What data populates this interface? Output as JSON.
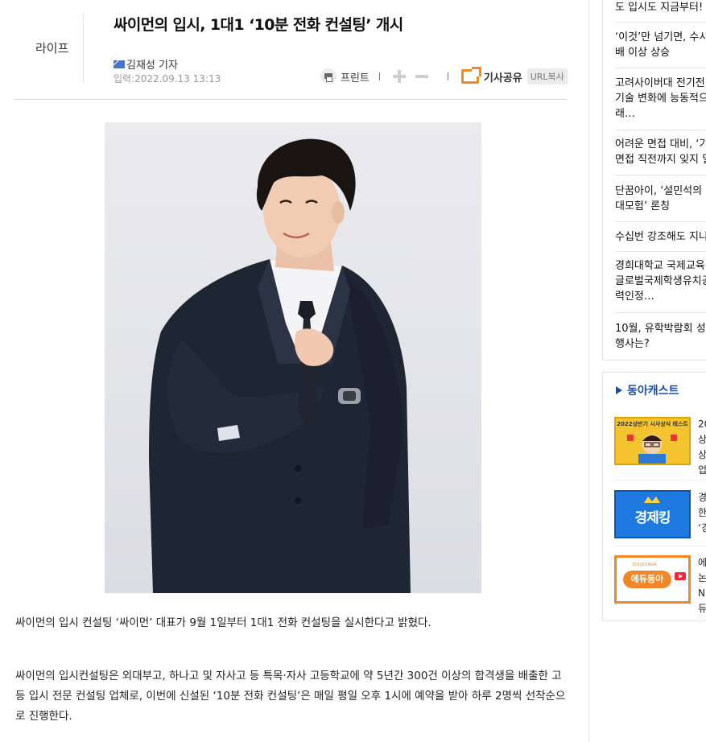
{
  "article": {
    "section": "라이프",
    "title": "싸이먼의 입시, 1대1 ‘10분 전화 컨설팅’ 개시",
    "author": "김재성 기자",
    "date": "입력:2022.09.13 13:13",
    "tools": {
      "print_label": "프린트",
      "share_label": "기사공유",
      "url_copy_label": "URL복사"
    },
    "paragraphs": [
      "싸이먼의 입시 컨설팅 ‘싸이먼’ 대표가 9월 1일부터 1대1 전화 컨설팅을 실시한다고 밝혔다.",
      "싸이먼의 입시컨설팅은 외대부고, 하나고 및 자사고 등 특목·자사 고등학교에 약 5년간 300건 이상의 합격생을 배출한 고등 입시 전문 컨설팅 업체로, 이번에 신설된 ‘10분 전화 컨설팅’은 매일 평일 오후 1시에 예약을 받아 하루 2명씩 선착순으로 진행한다."
    ]
  },
  "sidebar": {
    "rank_list": [
      [
        "도 입시도 지금부터!"
      ],
      [
        "‘이것’만 넘기면, 수시",
        "배 이상 상승"
      ],
      [
        "고려사이버대 전기전",
        "기술 변화에 능동적으",
        "래…"
      ],
      [
        "어려운 면접 대비, ‘기",
        "면접 직전까지 잊지 밀"
      ],
      [
        "단꿈아이, ‘설민석의 ː",
        "대모험’ 론칭"
      ],
      [
        "수십번 강조해도 지나"
      ],
      [
        "경희대학교 국제교육",
        "글로벌국제학생유치공",
        "력인정…"
      ],
      [
        "10월, 유학박람회 성",
        "행사는?"
      ]
    ],
    "cast": {
      "title": "동아캐스트",
      "items": [
        {
          "thumb_text": "2022상반기 시사상식 테스트",
          "lines": [
            "20",
            "상",
            "상",
            "업"
          ]
        },
        {
          "thumb_text": "경제킹",
          "lines": [
            "경",
            "한",
            "‘경"
          ]
        },
        {
          "thumb_text": "에듀동아",
          "thumb_top": "EDUDONGA",
          "lines": [
            "에",
            "논",
            "N",
            "듀"
          ]
        }
      ]
    }
  },
  "colors": {
    "share_orange": "#f08a24",
    "cast_blue": "#1a4fa8",
    "divider": "#dcdcdc"
  }
}
